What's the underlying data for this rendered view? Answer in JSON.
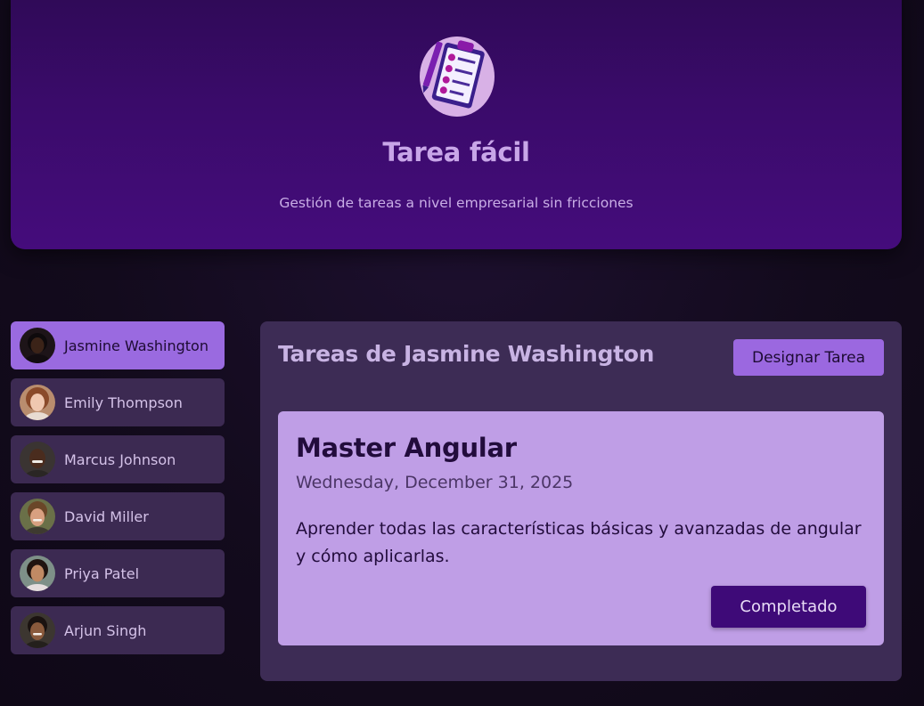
{
  "header": {
    "logo_icon": "clipboard-checklist-icon",
    "title": "Tarea fácil",
    "subtitle": "Gestión de tareas a nivel empresarial sin fricciones"
  },
  "users": [
    {
      "name": "Jasmine Washington",
      "selected": true
    },
    {
      "name": "Emily Thompson",
      "selected": false
    },
    {
      "name": "Marcus Johnson",
      "selected": false
    },
    {
      "name": "David Miller",
      "selected": false
    },
    {
      "name": "Priya Patel",
      "selected": false
    },
    {
      "name": "Arjun Singh",
      "selected": false
    }
  ],
  "tasks_panel": {
    "title": "Tareas de Jasmine Washington",
    "add_button": "Designar Tarea",
    "task": {
      "title": "Master Angular",
      "date": "Wednesday, December 31, 2025",
      "description": "Aprender todas las características básicas y avanzadas de angular y cómo aplicarlas.",
      "complete_button": "Completado"
    }
  },
  "colors": {
    "accent": "#9b68e0",
    "header_gradient_top": "#2e0a55",
    "header_gradient_bottom": "#450c7c",
    "card": "#bf9ee6",
    "panel": "#3d2c55",
    "complete_button": "#3e0a78"
  }
}
